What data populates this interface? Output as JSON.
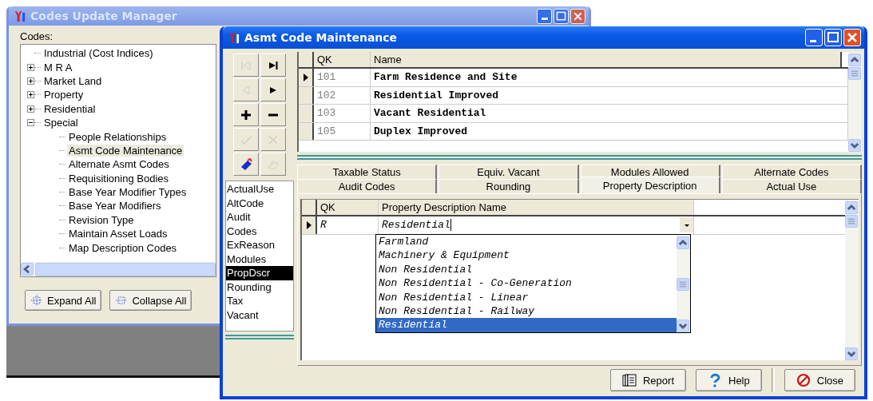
{
  "back_window": {
    "title": "Codes Update Manager",
    "codes_label": "Codes:",
    "tree": [
      {
        "label": "Industrial (Cost Indices)",
        "kind": "leaf",
        "selected": false
      },
      {
        "label": "M R A",
        "kind": "folder",
        "expanded": false,
        "selected": false
      },
      {
        "label": "Market Land",
        "kind": "folder",
        "expanded": false,
        "selected": false
      },
      {
        "label": "Property",
        "kind": "folder",
        "expanded": false,
        "selected": false
      },
      {
        "label": "Residential",
        "kind": "folder",
        "expanded": false,
        "selected": false
      },
      {
        "label": "Special",
        "kind": "folder",
        "expanded": true,
        "selected": false,
        "children": [
          {
            "label": "People Relationships",
            "selected": false
          },
          {
            "label": "Asmt Code Maintenance",
            "selected": true
          },
          {
            "label": "Alternate Asmt Codes",
            "selected": false
          },
          {
            "label": "Requisitioning Bodies",
            "selected": false
          },
          {
            "label": "Base Year Modifier Types",
            "selected": false
          },
          {
            "label": "Base Year Modifiers",
            "selected": false
          },
          {
            "label": "Revision Type",
            "selected": false
          },
          {
            "label": "Maintain Asset Loads",
            "selected": false
          },
          {
            "label": "Map Description Codes",
            "selected": false
          }
        ]
      }
    ],
    "buttons": [
      {
        "label": "Expand All",
        "kind": "expand"
      },
      {
        "label": "Collapse All",
        "kind": "collapse"
      }
    ]
  },
  "main_window": {
    "title": "Asmt Code Maintenance",
    "nav_buttons": [
      {
        "kind": "first",
        "disabled": true
      },
      {
        "kind": "last",
        "disabled": false
      },
      {
        "kind": "prior",
        "disabled": true
      },
      {
        "kind": "next",
        "disabled": false
      },
      {
        "kind": "insert",
        "disabled": false
      },
      {
        "kind": "delete",
        "disabled": false
      },
      {
        "kind": "post",
        "disabled": true
      },
      {
        "kind": "cancel",
        "disabled": true
      },
      {
        "kind": "bookmark",
        "disabled": false
      },
      {
        "kind": "goto",
        "disabled": true
      }
    ],
    "tables": [
      {
        "label": "ActualUse",
        "selected": false
      },
      {
        "label": "AltCode",
        "selected": false
      },
      {
        "label": "Audit",
        "selected": false
      },
      {
        "label": "Codes",
        "selected": false
      },
      {
        "label": "ExReason",
        "selected": false
      },
      {
        "label": "Modules",
        "selected": false
      },
      {
        "label": "PropDscr",
        "selected": true
      },
      {
        "label": "Rounding",
        "selected": false
      },
      {
        "label": "Tax",
        "selected": false
      },
      {
        "label": "Vacant",
        "selected": false
      }
    ],
    "code_grid": {
      "columns": [
        "QK",
        "Name"
      ],
      "rows": [
        {
          "qk": "101",
          "name": "Farm Residence and Site",
          "current": true
        },
        {
          "qk": "102",
          "name": "Residential Improved",
          "current": false
        },
        {
          "qk": "103",
          "name": "Vacant Residential",
          "current": false
        },
        {
          "qk": "105",
          "name": "Duplex Improved",
          "current": false
        }
      ]
    },
    "tab_rows": [
      [
        {
          "label": "Taxable Status",
          "selected": false
        },
        {
          "label": "Equiv. Vacant",
          "selected": false
        },
        {
          "label": "Modules Allowed",
          "selected": false
        },
        {
          "label": "Alternate Codes",
          "selected": false
        }
      ],
      [
        {
          "label": "Audit Codes",
          "selected": false
        },
        {
          "label": "Rounding",
          "selected": false
        },
        {
          "label": "Property Description",
          "selected": true
        },
        {
          "label": "Actual Use",
          "selected": false
        }
      ]
    ],
    "detail_grid": {
      "columns": [
        "QK",
        "Property Description Name"
      ],
      "rows": [
        {
          "qk": "R",
          "name": "Residential",
          "current": true
        }
      ],
      "dropdown": [
        {
          "label": "Farmland",
          "selected": false
        },
        {
          "label": "Machinery & Equipment",
          "selected": false
        },
        {
          "label": "Non Residential",
          "selected": false
        },
        {
          "label": "Non Residential - Co-Generation",
          "selected": false
        },
        {
          "label": "Non Residential - Linear",
          "selected": false
        },
        {
          "label": "Non Residential - Railway",
          "selected": false
        },
        {
          "label": "Residential",
          "selected": true
        }
      ]
    },
    "buttons": [
      {
        "label": "Report",
        "kind": "report"
      },
      {
        "label": "Help",
        "kind": "help"
      },
      {
        "label": "Close",
        "kind": "close"
      }
    ]
  }
}
